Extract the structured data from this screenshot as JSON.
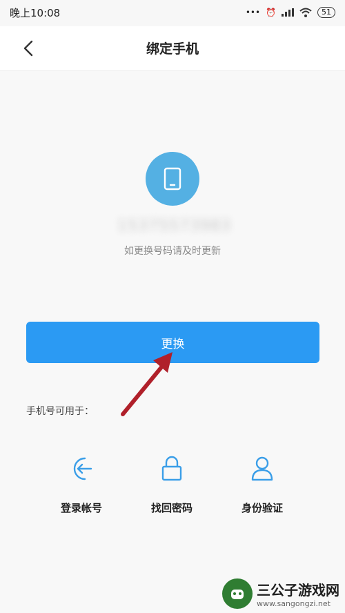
{
  "status_bar": {
    "time": "晚上10:08",
    "icons": [
      "dots-icon",
      "alarm-icon",
      "signal-icon",
      "wifi-icon"
    ],
    "battery": "51"
  },
  "nav": {
    "title": "绑定手机",
    "back_icon": "chevron-left-icon"
  },
  "phone": {
    "masked_number": "15375573983",
    "hint": "如更换号码请及时更新"
  },
  "change_button_label": "更换",
  "usage_label": "手机号可用于：",
  "features": [
    {
      "label": "登录帐号",
      "icon": "login-icon"
    },
    {
      "label": "找回密码",
      "icon": "lock-icon"
    },
    {
      "label": "身份验证",
      "icon": "user-icon"
    }
  ],
  "watermark": {
    "title": "三公子游戏网",
    "url": "www.sangongzi.net"
  },
  "colors": {
    "accent": "#2b9af3",
    "phone_circle": "#54b0e3",
    "arrow": "#b0202a",
    "feature_icon": "#3a9ee8"
  }
}
